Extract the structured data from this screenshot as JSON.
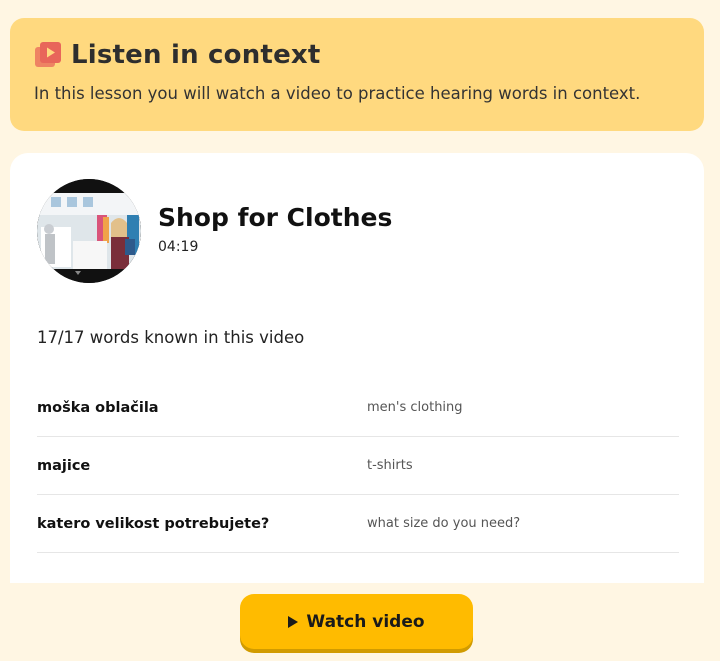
{
  "banner": {
    "icon": "video-playlist-icon",
    "title": "Listen in context",
    "subtitle": "In this lesson you will watch a video to practice hearing words in context."
  },
  "video": {
    "thumbnail": "video-thumbnail",
    "title": "Shop for Clothes",
    "duration": "04:19",
    "known_words": "17/17 words known in this video"
  },
  "words": [
    {
      "word": "moška oblačila",
      "translation": "men's clothing"
    },
    {
      "word": "majice",
      "translation": "t-shirts"
    },
    {
      "word": "katero velikost potrebujete?",
      "translation": "what size do you need?"
    }
  ],
  "actions": {
    "watch_label": "Watch video",
    "watch_icon": "play-icon"
  },
  "colors": {
    "page_bg": "#fff6e3",
    "banner_bg": "#ffd97f",
    "icon": "#e8665a",
    "button": "#ffbb00"
  }
}
